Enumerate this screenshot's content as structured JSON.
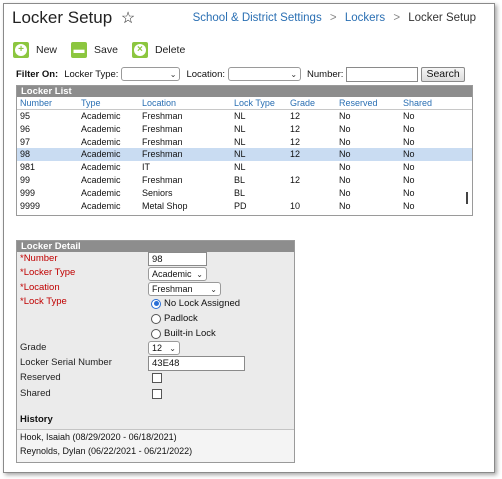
{
  "page": {
    "title": "Locker Setup",
    "breadcrumbs": [
      "School & District Settings",
      "Lockers",
      "Locker Setup"
    ]
  },
  "toolbar": {
    "new_label": "New",
    "save_label": "Save",
    "delete_label": "Delete"
  },
  "filter": {
    "title": "Filter On:",
    "locker_type_label": "Locker Type:",
    "locker_type_value": "",
    "location_label": "Location:",
    "location_value": "",
    "number_label": "Number:",
    "number_value": "",
    "search_label": "Search"
  },
  "locker_list": {
    "title": "Locker List",
    "columns": [
      "Number",
      "Type",
      "Location",
      "Lock Type",
      "Grade",
      "Reserved",
      "Shared"
    ],
    "rows": [
      [
        "95",
        "Academic",
        "Freshman",
        "NL",
        "12",
        "No",
        "No"
      ],
      [
        "96",
        "Academic",
        "Freshman",
        "NL",
        "12",
        "No",
        "No"
      ],
      [
        "97",
        "Academic",
        "Freshman",
        "NL",
        "12",
        "No",
        "No"
      ],
      [
        "98",
        "Academic",
        "Freshman",
        "NL",
        "12",
        "No",
        "No"
      ],
      [
        "981",
        "Academic",
        "IT",
        "NL",
        "",
        "No",
        "No"
      ],
      [
        "99",
        "Academic",
        "Freshman",
        "BL",
        "12",
        "No",
        "No"
      ],
      [
        "999",
        "Academic",
        "Seniors",
        "BL",
        "",
        "No",
        "No"
      ],
      [
        "9999",
        "Academic",
        "Metal Shop",
        "PD",
        "10",
        "No",
        "No"
      ]
    ],
    "selected_row": 3
  },
  "detail": {
    "title": "Locker Detail",
    "number_label": "*Number",
    "number_value": "98",
    "locker_type_label": "*Locker Type",
    "locker_type_value": "Academic",
    "location_label": "*Location",
    "location_value": "Freshman",
    "lock_type_label": "*Lock Type",
    "lock_options": [
      "No Lock Assigned",
      "Padlock",
      "Built-in Lock"
    ],
    "lock_selected": "No Lock Assigned",
    "grade_label": "Grade",
    "grade_value": "12",
    "serial_label": "Locker Serial Number",
    "serial_value": "43E48",
    "reserved_label": "Reserved",
    "reserved_checked": false,
    "shared_label": "Shared",
    "shared_checked": false,
    "history_label": "History",
    "history": [
      "Hook, Isaiah (08/29/2020 - 06/18/2021)",
      "Reynolds, Dylan (06/22/2021 - 06/21/2022)"
    ]
  },
  "colors": {
    "accent": "#8cc63f",
    "link": "#2a6fb3",
    "required": "#c00000",
    "header_bar": "#8d8d8d",
    "selected_row": "#c9dcf2"
  }
}
